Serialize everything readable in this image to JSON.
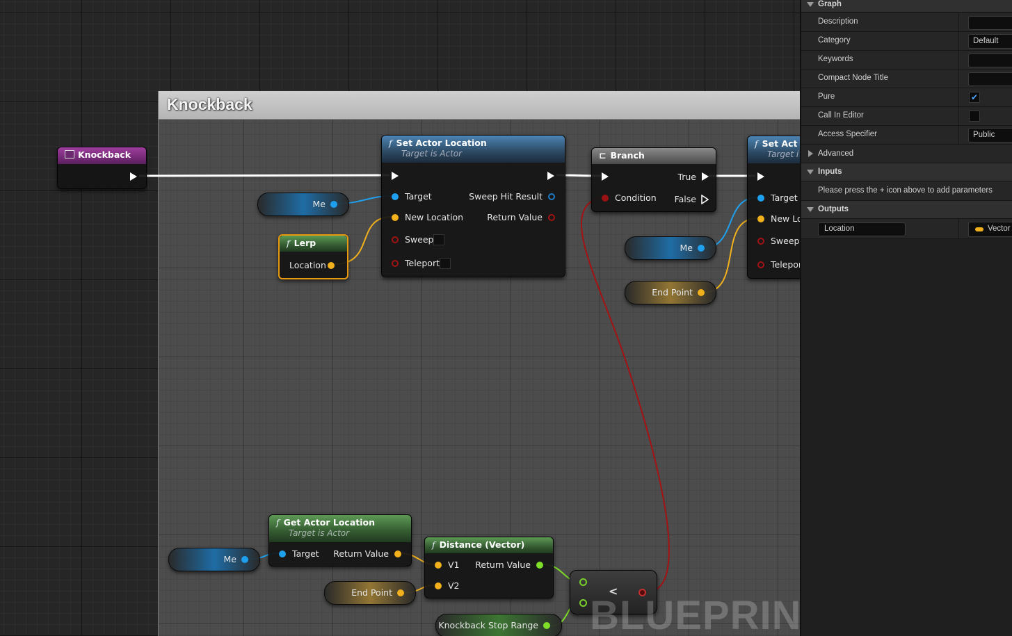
{
  "comment_title": "Knockback",
  "watermark": "BLUEPRINT",
  "nodes": {
    "event": {
      "title": "Knockback"
    },
    "set_actor_location_1": {
      "title": "Set Actor Location",
      "subtitle": "Target is Actor",
      "inputs": [
        "Target",
        "New Location",
        "Sweep",
        "Teleport"
      ],
      "outputs": [
        "Sweep Hit Result",
        "Return Value"
      ]
    },
    "branch": {
      "title": "Branch",
      "condition": "Condition",
      "true_label": "True",
      "false_label": "False"
    },
    "set_actor_location_2": {
      "title": "Set Act",
      "subtitle": "Target i",
      "inputs": [
        "Target",
        "New Lo",
        "Sweep",
        "Telepor"
      ]
    },
    "lerp": {
      "title": "Lerp",
      "output": "Location"
    },
    "get_actor_location": {
      "title": "Get Actor Location",
      "subtitle": "Target is Actor",
      "input": "Target",
      "output": "Return Value"
    },
    "distance": {
      "title": "Distance (Vector)",
      "inputs": [
        "V1",
        "V2"
      ],
      "output": "Return Value"
    },
    "compare": {
      "symbol": "<"
    }
  },
  "variables": {
    "me": "Me",
    "end_point": "End Point",
    "knockback_stop_range": "Knockback Stop Range"
  },
  "details": {
    "sections": {
      "graph": "Graph",
      "advanced": "Advanced",
      "inputs": "Inputs",
      "outputs": "Outputs"
    },
    "fields": {
      "description": "Description",
      "category": "Category",
      "category_value": "Default",
      "keywords": "Keywords",
      "compact_node_title": "Compact Node Title",
      "pure": "Pure",
      "pure_checked": true,
      "call_in_editor": "Call In Editor",
      "access_specifier": "Access Specifier",
      "access_specifier_value": "Public"
    },
    "inputs_hint": "Please press the + icon above to add parameters",
    "output_param": {
      "name": "Location",
      "type": "Vector",
      "type_color": "#f1b01c"
    }
  },
  "colors": {
    "exec_wire": "#ffffff",
    "object_wire": "#1fa0ee",
    "vector_wire": "#f1b01c",
    "bool_wire": "#a31313",
    "float_wire": "#7ede28",
    "lerp_border": "#e79a10"
  }
}
